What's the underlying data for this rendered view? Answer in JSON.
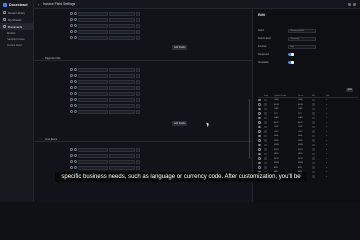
{
  "app": {
    "name": "Docextract",
    "title": "Invoice Field Settings"
  },
  "sidebar": {
    "items": [
      {
        "label": "Model Library"
      },
      {
        "label": "My Models"
      },
      {
        "label": "Documents"
      }
    ],
    "subitems": [
      {
        "label": "Models"
      },
      {
        "label": "Sample Invoice"
      },
      {
        "label": "Invoice Field"
      }
    ]
  },
  "main": {
    "sections": [
      {
        "label": "Payment Info"
      },
      {
        "label": "Line Items"
      }
    ],
    "add_fields_label": "Add Fields"
  },
  "panel": {
    "title": "Edit",
    "fields": [
      {
        "label": "Field:",
        "value": "Currency field"
      },
      {
        "label": "Field Label:",
        "value": "Currency"
      },
      {
        "label": "Format:",
        "value": "Text"
      },
      {
        "label": "Required:"
      },
      {
        "label": "Viewable:"
      }
    ],
    "add_label": "Add",
    "table_headers": [
      "",
      "Item",
      "Option Code",
      "Desc",
      "Ms",
      "Del"
    ],
    "table_rows": [
      {
        "item": "USD",
        "desc": "USD"
      },
      {
        "item": "EUR",
        "desc": "EUR"
      },
      {
        "item": "GBP",
        "desc": "GBP"
      },
      {
        "item": "JPY",
        "desc": "JPY"
      },
      {
        "item": "CAD",
        "desc": "CAD"
      },
      {
        "item": "AUD",
        "desc": "AUD"
      },
      {
        "item": "CHF",
        "desc": "CHF"
      },
      {
        "item": "CNY",
        "desc": "CNY"
      },
      {
        "item": "SEK",
        "desc": "SEK"
      },
      {
        "item": "NZD",
        "desc": "NZD"
      },
      {
        "item": "MXN",
        "desc": "MXN"
      },
      {
        "item": "SGD",
        "desc": "SGD"
      },
      {
        "item": "HKD",
        "desc": "HKD"
      },
      {
        "item": "NOK",
        "desc": "NOK"
      },
      {
        "item": "KRW",
        "desc": "KRW"
      },
      {
        "item": "INR",
        "desc": "INR"
      },
      {
        "item": "BRL",
        "desc": "BRL"
      },
      {
        "item": "ZAR",
        "desc": "ZAR"
      }
    ]
  },
  "caption": "specific business needs, such as language or currency code. After customization, you'll be",
  "colors": {
    "accent": "#3b82f6",
    "background": "#0f1115"
  }
}
